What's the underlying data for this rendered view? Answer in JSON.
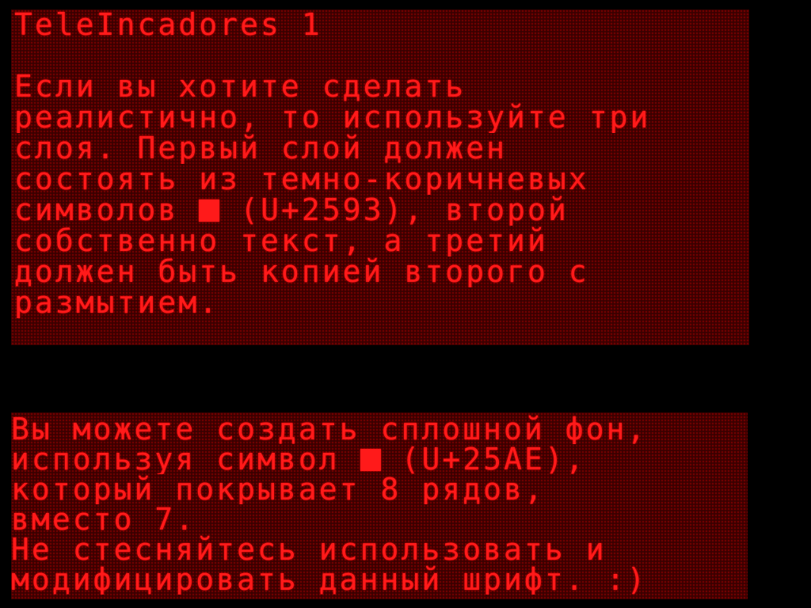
{
  "colors": {
    "background": "#000000",
    "panel": "#3a0000",
    "led_off": "#6e0000",
    "text": "#ff1a1a"
  },
  "top_panel": {
    "title": "TeleIncadores 1",
    "lines": [
      "Если вы хотите сделать",
      "реалистично, то используйте три",
      "слоя. Первый слой должен",
      "состоять из темно-коричневых",
      "символов ",
      " (U+2593), второй",
      "собственно текст, а третий",
      "должен быть копией второго с",
      "размытием."
    ]
  },
  "bottom_panel": {
    "lines": [
      "Вы можете создать сплошной фон,",
      "используя символ ",
      " (U+25AE),",
      "который покрывает 8 рядов,",
      "вместо 7.",
      "Не стесняйтесь использовать и",
      "модифицировать данный шрифт. :)"
    ]
  }
}
